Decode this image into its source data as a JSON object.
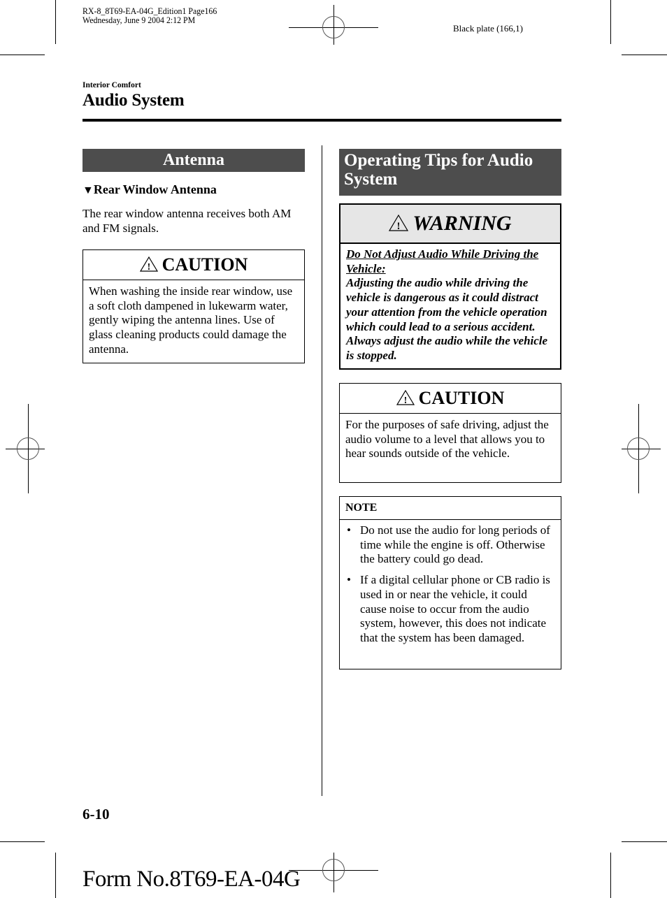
{
  "print_info": {
    "line1": "RX-8_8T69-EA-04G_Edition1 Page166",
    "line2": "Wednesday, June 9 2004 2:12 PM",
    "plate": "Black plate (166,1)"
  },
  "header": {
    "section": "Interior Comfort",
    "title": "Audio System"
  },
  "left_column": {
    "heading": "Antenna",
    "subheading_marker": "▼",
    "subheading": "Rear Window Antenna",
    "paragraph": "The rear window antenna receives both AM and FM signals.",
    "caution": {
      "icon": "warning-triangle-icon",
      "title": "CAUTION",
      "text": "When washing the inside rear window, use a soft cloth dampened in lukewarm water, gently wiping the antenna lines. Use of glass cleaning products could damage the antenna."
    }
  },
  "right_column": {
    "heading": "Operating Tips for Audio System",
    "warning": {
      "icon": "warning-triangle-icon",
      "title": "WARNING",
      "subtitle": "Do Not Adjust Audio While Driving the Vehicle:",
      "text": "Adjusting the audio while driving the vehicle is dangerous as it could distract your attention from the vehicle operation which could lead to a serious accident. Always adjust the audio while the vehicle is stopped."
    },
    "caution": {
      "icon": "warning-triangle-icon",
      "title": "CAUTION",
      "text": "For the purposes of safe driving, adjust the audio volume to a level that allows you to hear sounds outside of the vehicle."
    },
    "note": {
      "title": "NOTE",
      "bullet": "•",
      "items": [
        "Do not use the audio for long periods of time while the engine is off. Otherwise the battery could go dead.",
        "If a digital cellular phone or CB radio is used in or near the vehicle, it could cause noise to occur from the audio system, however, this does not indicate that the system has been damaged."
      ]
    }
  },
  "footer": {
    "page_number": "6-10",
    "form_number": "Form No.8T69-EA-04G"
  },
  "colors": {
    "heading_bar": "#4d4d4d",
    "warning_header_bg": "#e6e6e6",
    "text": "#000000"
  }
}
